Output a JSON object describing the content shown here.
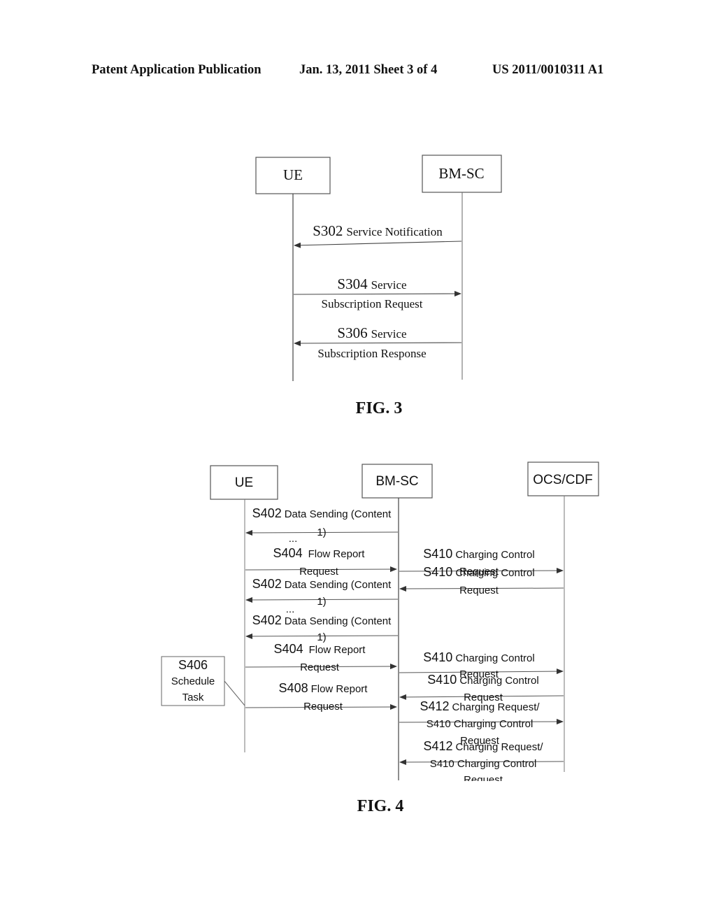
{
  "header": {
    "left": "Patent Application Publication",
    "date_sheet": "Jan. 13, 2011   Sheet 3 of 4",
    "number": "US 2011/0010311 A1"
  },
  "fig3": {
    "caption": "FIG. 3",
    "entities": [
      {
        "id": "ue",
        "label": "UE"
      },
      {
        "id": "bmsc",
        "label": "BM-SC"
      }
    ],
    "messages": [
      {
        "step": "S302",
        "lines": [
          "Service Notification"
        ],
        "from": "bmsc",
        "to": "ue"
      },
      {
        "step": "S304",
        "lines": [
          "Service",
          "Subscription Request"
        ],
        "from": "ue",
        "to": "bmsc"
      },
      {
        "step": "S306",
        "lines": [
          "Service",
          "Subscription Response"
        ],
        "from": "bmsc",
        "to": "ue"
      }
    ]
  },
  "fig4": {
    "caption": "FIG. 4",
    "entities": [
      {
        "id": "ue",
        "label": "UE"
      },
      {
        "id": "bmsc",
        "label": "BM-SC"
      },
      {
        "id": "ocs",
        "label": "OCS/CDF"
      }
    ],
    "side_box": {
      "step": "S406",
      "lines": [
        "Schedule",
        "Task"
      ]
    },
    "ellipsis": "...",
    "messages": [
      {
        "step": "S402",
        "lines": [
          "Data Sending (Content",
          "1)"
        ],
        "from": "bmsc",
        "to": "ue"
      },
      {
        "step": "S404",
        "lines": [
          "Flow Report",
          "Request"
        ],
        "from": "ue",
        "to": "bmsc"
      },
      {
        "step": "S410",
        "lines": [
          "Charging Control",
          "Request"
        ],
        "from": "bmsc",
        "to": "ocs"
      },
      {
        "step": "S410",
        "lines": [
          "Charging Control",
          "Request"
        ],
        "from": "ocs",
        "to": "bmsc"
      },
      {
        "step": "S402",
        "lines": [
          "Data Sending (Content",
          "1)"
        ],
        "from": "bmsc",
        "to": "ue"
      },
      {
        "step": "S402",
        "lines": [
          "Data Sending (Content",
          "1)"
        ],
        "from": "bmsc",
        "to": "ue"
      },
      {
        "step": "S404",
        "lines": [
          "Flow Report",
          "Request"
        ],
        "from": "ue",
        "to": "bmsc"
      },
      {
        "step": "S410",
        "lines": [
          "Charging Control",
          "Request"
        ],
        "from": "bmsc",
        "to": "ocs"
      },
      {
        "step": "S410",
        "lines": [
          "Charging Control",
          "Request"
        ],
        "from": "ocs",
        "to": "bmsc"
      },
      {
        "step": "S408",
        "lines": [
          "Flow Report",
          "Request"
        ],
        "from": "ue",
        "to": "bmsc"
      },
      {
        "step": "S412",
        "lines": [
          "Charging Request/",
          "S410 Charging Control",
          "Request"
        ],
        "from": "bmsc",
        "to": "ocs"
      },
      {
        "step": "S412",
        "lines": [
          "Charging Request/",
          "S410 Charging Control",
          "Request"
        ],
        "from": "ocs",
        "to": "bmsc"
      }
    ]
  }
}
